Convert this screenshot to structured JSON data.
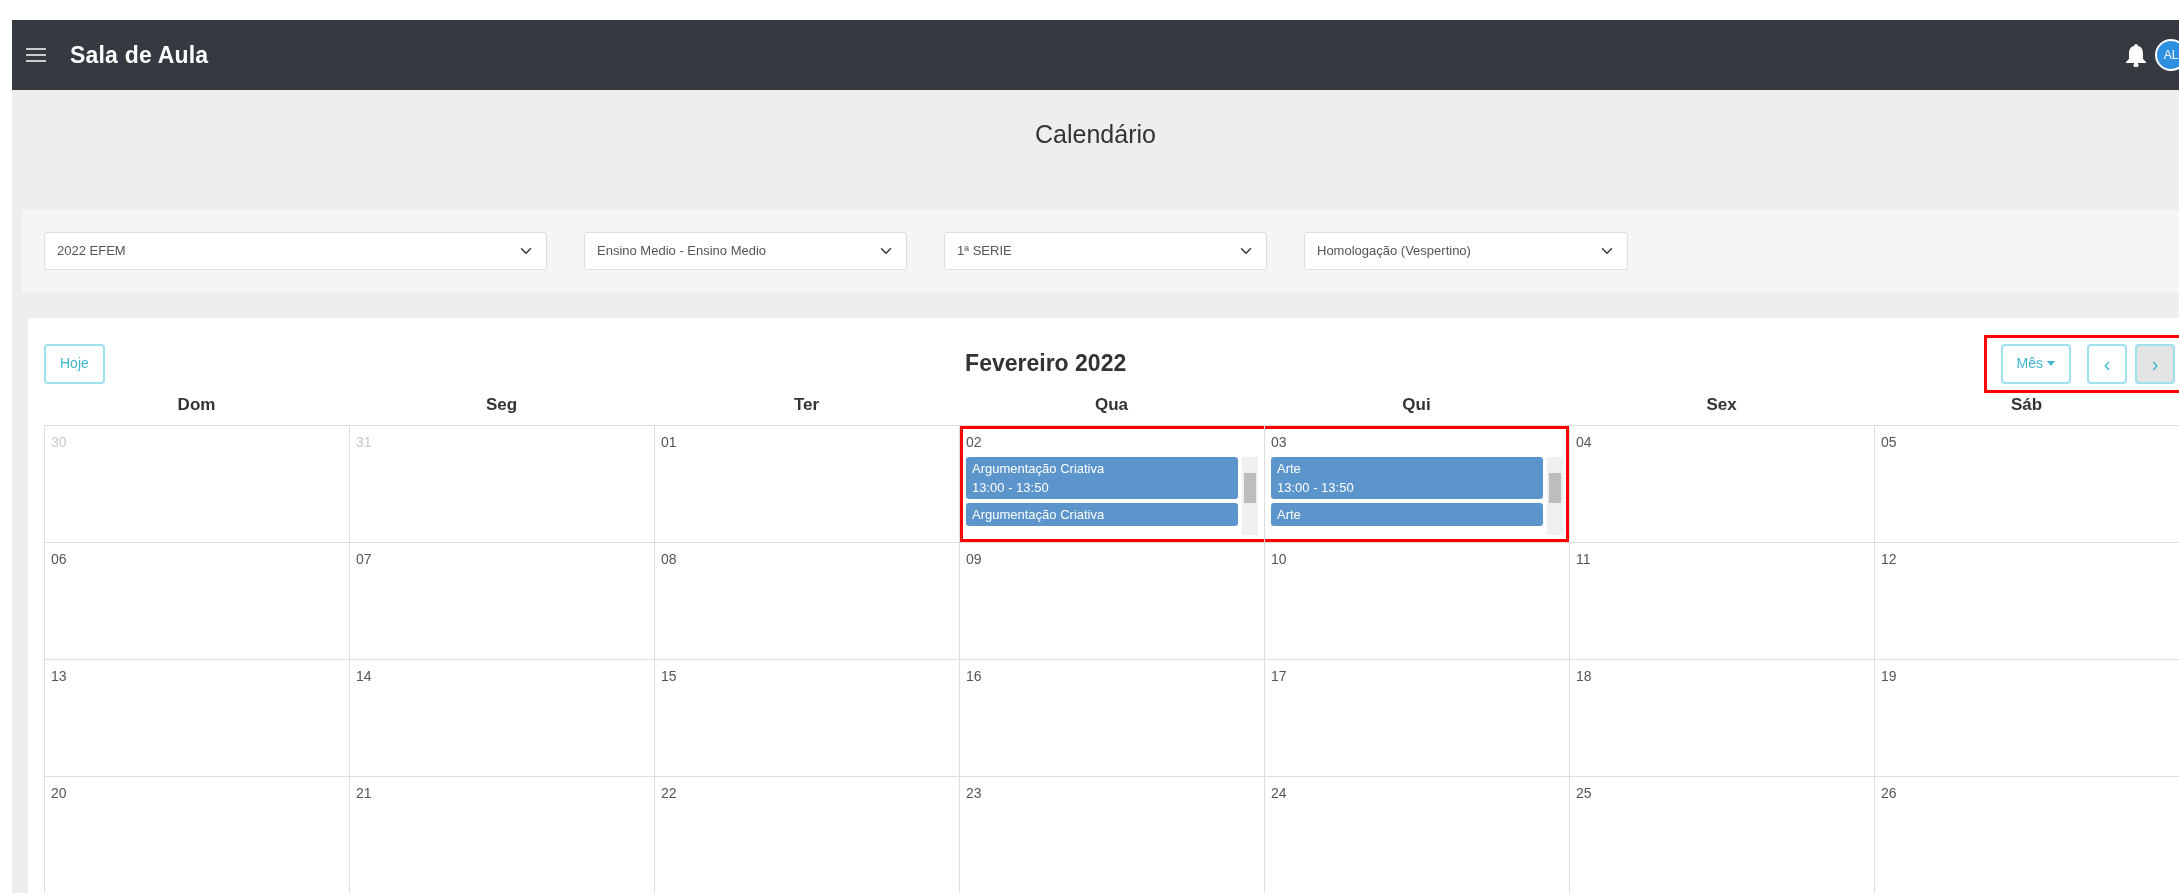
{
  "app_bar": {
    "title": "Sala de Aula",
    "avatar_initials": "AL"
  },
  "page_title": "Calendário",
  "filters": [
    {
      "value": "2022 EFEM"
    },
    {
      "value": "Ensino Medio - Ensino Medio"
    },
    {
      "value": "1ª SERIE"
    },
    {
      "value": "Homologação (Vespertino)"
    }
  ],
  "calendar": {
    "today_button": "Hoje",
    "title": "Fevereiro 2022",
    "view_button": "Mês",
    "prev_button": "‹",
    "next_button": "›",
    "controls_highlighted": true,
    "weekdays": [
      "Dom",
      "Seg",
      "Ter",
      "Qua",
      "Qui",
      "Sex",
      "Sáb"
    ],
    "weeks": [
      [
        {
          "day": "30",
          "other_month": true,
          "highlighted": false
        },
        {
          "day": "31",
          "other_month": true,
          "highlighted": false
        },
        {
          "day": "01",
          "other_month": false,
          "highlighted": false
        },
        {
          "day": "02",
          "other_month": false,
          "highlighted": true,
          "events": [
            {
              "title": "Argumentação Criativa",
              "time": "13:00 - 13:50"
            },
            {
              "title": "Argumentação Criativa"
            }
          ]
        },
        {
          "day": "03",
          "other_month": false,
          "highlighted": true,
          "events": [
            {
              "title": "Arte",
              "time": "13:00 - 13:50"
            },
            {
              "title": "Arte"
            }
          ]
        },
        {
          "day": "04",
          "other_month": false,
          "highlighted": false
        },
        {
          "day": "05",
          "other_month": false,
          "highlighted": false
        }
      ],
      [
        {
          "day": "06",
          "other_month": false,
          "highlighted": false
        },
        {
          "day": "07",
          "other_month": false,
          "highlighted": false
        },
        {
          "day": "08",
          "other_month": false,
          "highlighted": false
        },
        {
          "day": "09",
          "other_month": false,
          "highlighted": false
        },
        {
          "day": "10",
          "other_month": false,
          "highlighted": false
        },
        {
          "day": "11",
          "other_month": false,
          "highlighted": false
        },
        {
          "day": "12",
          "other_month": false,
          "highlighted": false
        }
      ],
      [
        {
          "day": "13",
          "other_month": false,
          "highlighted": false
        },
        {
          "day": "14",
          "other_month": false,
          "highlighted": false
        },
        {
          "day": "15",
          "other_month": false,
          "highlighted": false
        },
        {
          "day": "16",
          "other_month": false,
          "highlighted": false
        },
        {
          "day": "17",
          "other_month": false,
          "highlighted": false
        },
        {
          "day": "18",
          "other_month": false,
          "highlighted": false
        },
        {
          "day": "19",
          "other_month": false,
          "highlighted": false
        }
      ],
      [
        {
          "day": "20",
          "other_month": false,
          "highlighted": false
        },
        {
          "day": "21",
          "other_month": false,
          "highlighted": false
        },
        {
          "day": "22",
          "other_month": false,
          "highlighted": false
        },
        {
          "day": "23",
          "other_month": false,
          "highlighted": false
        },
        {
          "day": "24",
          "other_month": false,
          "highlighted": false
        },
        {
          "day": "25",
          "other_month": false,
          "highlighted": false
        },
        {
          "day": "26",
          "other_month": false,
          "highlighted": false
        }
      ]
    ]
  }
}
